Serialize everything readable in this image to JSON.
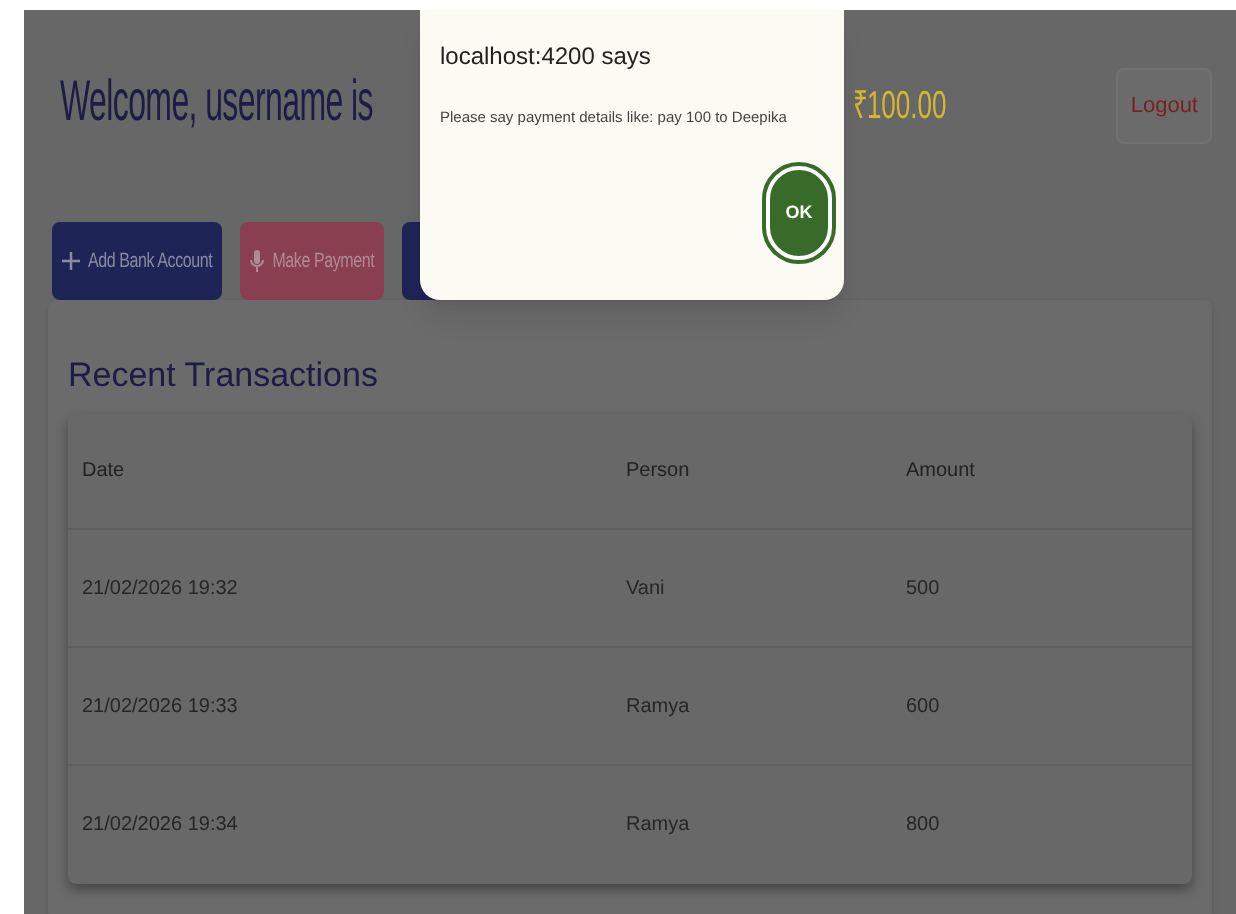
{
  "header": {
    "welcome": "Welcome, username is",
    "balance": "₹100.00",
    "logout": "Logout"
  },
  "actions": [
    {
      "label": "Add Bank Account",
      "kind": "add"
    },
    {
      "label": "Make Payment",
      "kind": "mic"
    },
    {
      "kind": "plain"
    }
  ],
  "transactions": {
    "title": "Recent Transactions",
    "columns": [
      "Date",
      "Person",
      "Amount"
    ],
    "rows": [
      [
        "21/02/2026 19:32",
        "Vani",
        "500"
      ],
      [
        "21/02/2026 19:33",
        "Ramya",
        "600"
      ],
      [
        "21/02/2026 19:34",
        "Ramya",
        "800"
      ]
    ]
  },
  "dialog": {
    "title": "localhost:4200 says",
    "message": "Please say payment details like: pay 100 to Deepika",
    "button": "OK"
  }
}
